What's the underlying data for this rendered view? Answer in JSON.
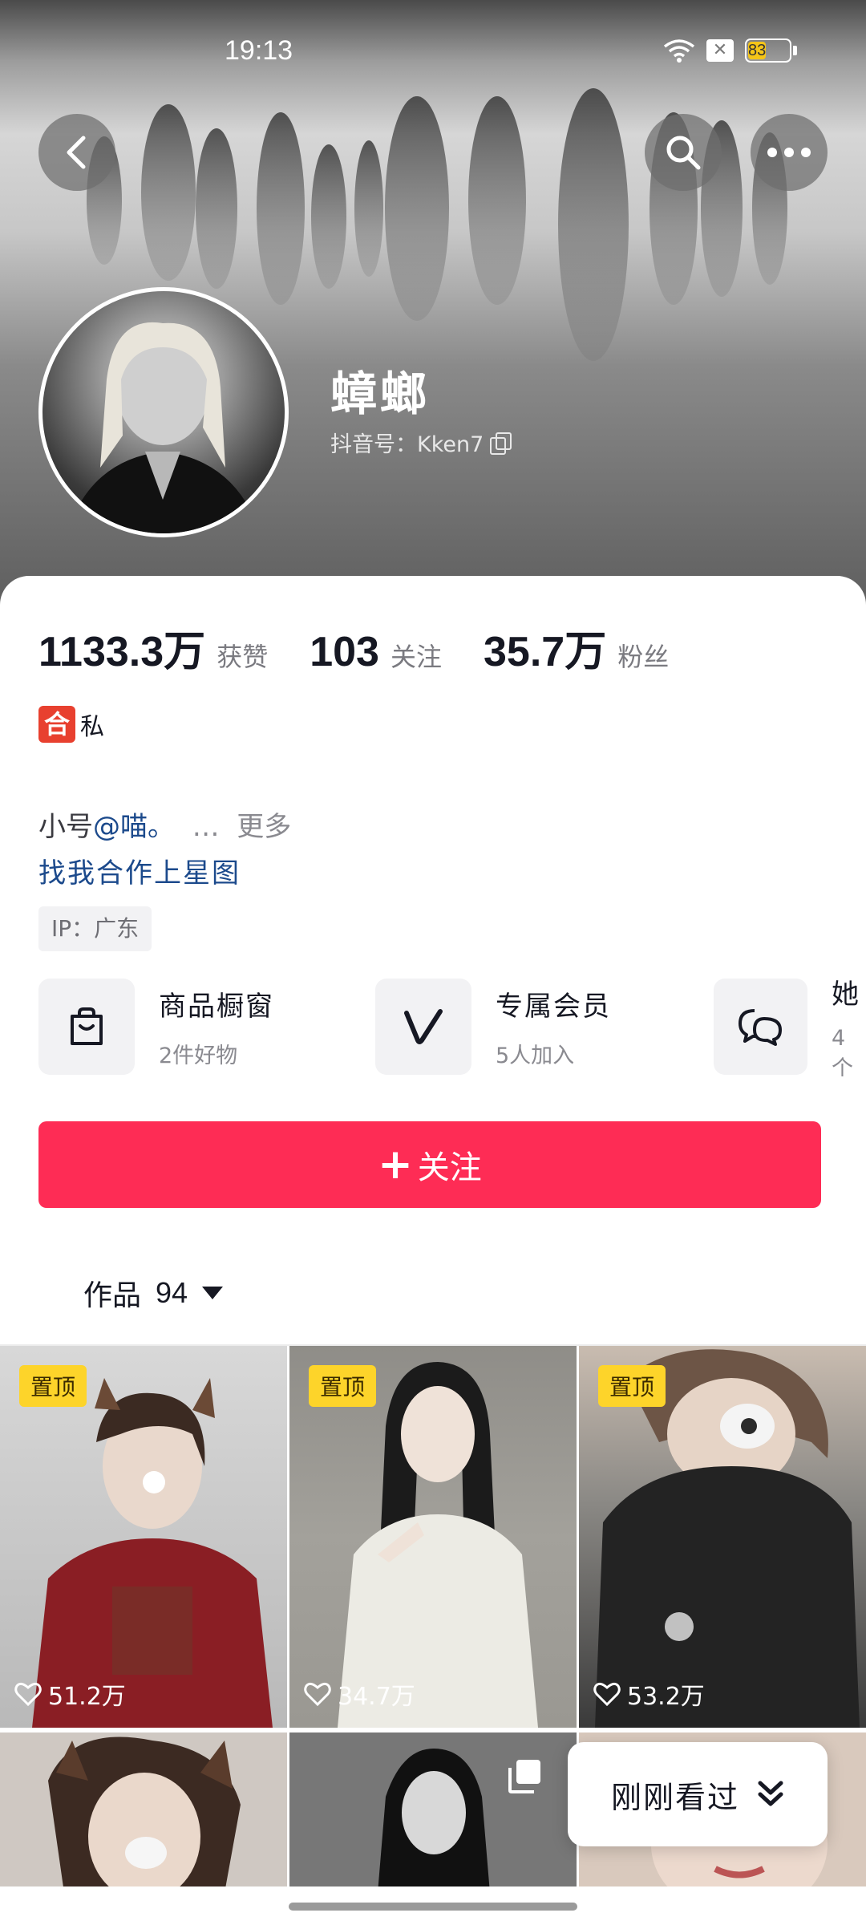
{
  "status_bar": {
    "time": "19:13",
    "battery": "83"
  },
  "profile": {
    "nickname": "蟑螂",
    "douyin_id": "抖音号：Kken7"
  },
  "stats": [
    {
      "value": "1133.3万",
      "label": "获赞"
    },
    {
      "value": "103",
      "label": "关注"
    },
    {
      "value": "35.7万",
      "label": "粉丝"
    }
  ],
  "tag": {
    "badge": "合",
    "text": "私"
  },
  "bio": {
    "prefix": "小号",
    "mention": "@喵。",
    "ellipsis": "…",
    "more": "更多",
    "line2": "找我合作上星图"
  },
  "ip": "IP：广东",
  "services": [
    {
      "title": "商品橱窗",
      "subtitle": "2件好物",
      "icon": "shopping-bag-icon"
    },
    {
      "title": "专属会员",
      "subtitle": "5人加入",
      "icon": "v-member-icon"
    },
    {
      "title": "她",
      "subtitle": "4个",
      "icon": "chat-bubble-icon"
    }
  ],
  "follow_button": {
    "label": "关注"
  },
  "works_tab": {
    "label": "作品",
    "count": "94"
  },
  "videos": [
    {
      "pinned": "置顶",
      "likes": "51.2万"
    },
    {
      "pinned": "置顶",
      "likes": "34.7万"
    },
    {
      "pinned": "置顶",
      "likes": "53.2万"
    }
  ],
  "recent_popup": {
    "label": "刚刚看过"
  },
  "colors": {
    "accent": "#fe2c55",
    "pin": "#fdd42a",
    "link": "#1c4a8c"
  }
}
